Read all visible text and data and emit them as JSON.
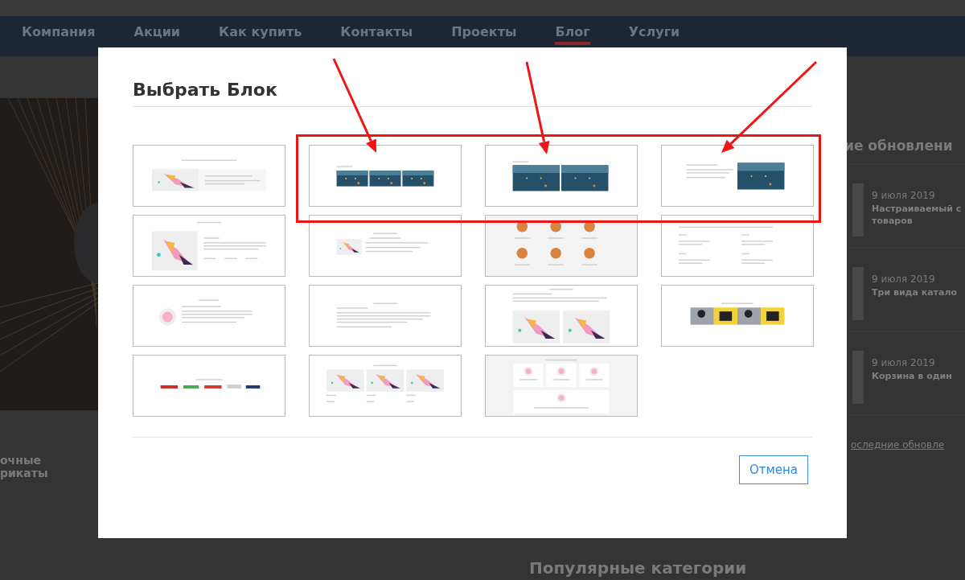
{
  "top_nav": {
    "items": [
      {
        "label": "Компания",
        "selected": false
      },
      {
        "label": "Акции",
        "selected": false
      },
      {
        "label": "Как купить",
        "selected": false
      },
      {
        "label": "Контакты",
        "selected": false
      },
      {
        "label": "Проекты",
        "selected": false
      },
      {
        "label": "Блог",
        "selected": true
      },
      {
        "label": "Услуги",
        "selected": false
      }
    ]
  },
  "hero_side": {
    "lines": [
      "очные",
      "рикаты"
    ]
  },
  "updates": {
    "heading": "ие обновлени",
    "items": [
      {
        "date": "9 июля 2019",
        "title_lines": [
          "Настраиваемый с",
          "товаров"
        ]
      },
      {
        "date": "9 июля 2019",
        "title_lines": [
          "Три вида катало"
        ]
      },
      {
        "date": "9 июля 2019",
        "title_lines": [
          "Корзина в один"
        ]
      }
    ],
    "link": "оследние обновле"
  },
  "popular": {
    "heading": "Популярные категории"
  },
  "modal": {
    "title": "Выбрать Блок",
    "blocks": [
      {
        "kind": "hero"
      },
      {
        "kind": "gallery3"
      },
      {
        "kind": "gallery2"
      },
      {
        "kind": "textphoto"
      },
      {
        "kind": "feature"
      },
      {
        "kind": "aboutsmall"
      },
      {
        "kind": "products"
      },
      {
        "kind": "numbered"
      },
      {
        "kind": "aboutcircle"
      },
      {
        "kind": "text"
      },
      {
        "kind": "textgallery"
      },
      {
        "kind": "banners"
      },
      {
        "kind": "partners"
      },
      {
        "kind": "services"
      },
      {
        "kind": "advantages"
      }
    ],
    "cancel": "Отмена"
  }
}
